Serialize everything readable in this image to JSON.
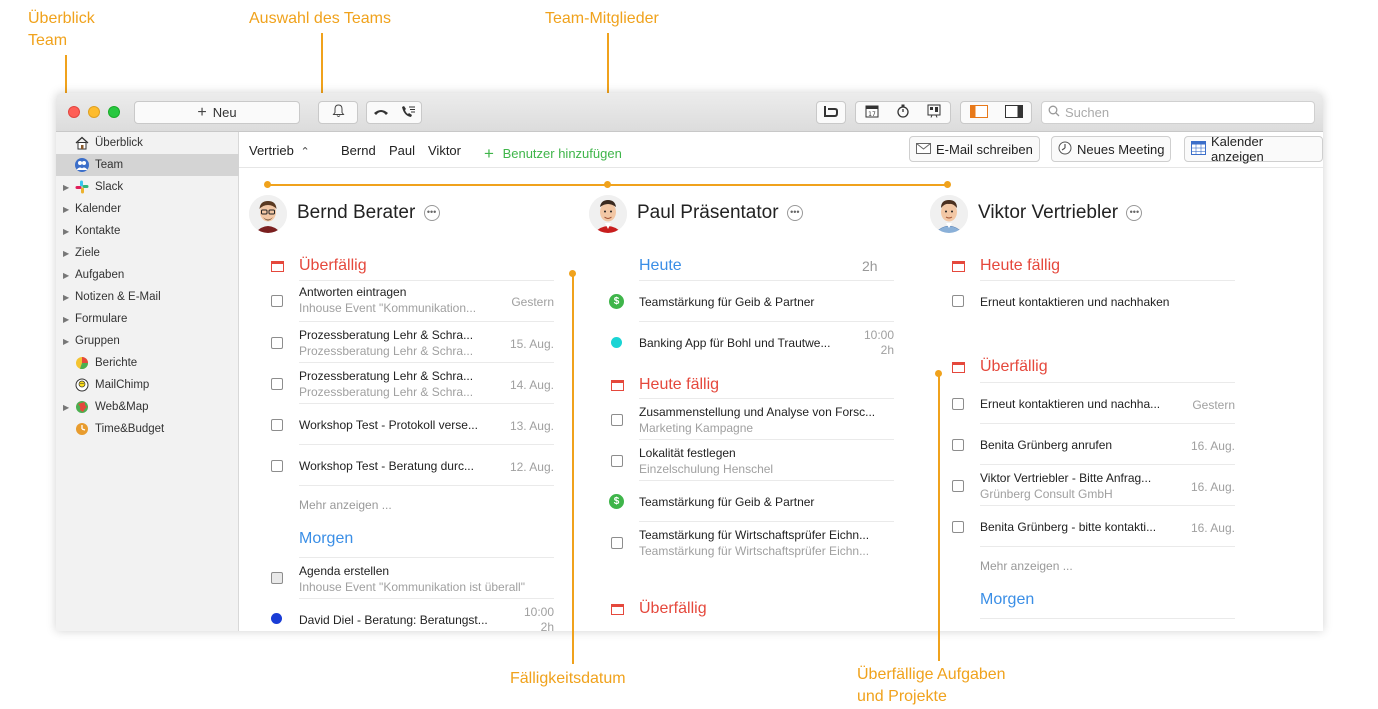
{
  "callouts": {
    "overview_team_line1": "Überblick",
    "overview_team_line2": "Team",
    "team_selection": "Auswahl des Teams",
    "team_members": "Team-Mitglieder",
    "due_date": "Fälligkeitsdatum",
    "overdue_line1": "Überfällige Aufgaben",
    "overdue_line2": "und Projekte"
  },
  "colors": {
    "accent": "#f0a21c",
    "red": "#e5483c",
    "blue": "#3a8ee6",
    "green": "#3fb54a"
  },
  "toolbar": {
    "new_label": "Neu",
    "search_placeholder": "Suchen",
    "icons": [
      "bell-icon",
      "hangup-icon",
      "call-list-icon",
      "brand-icon",
      "calendar-icon",
      "timer-icon",
      "board-icon",
      "sidebar-left-icon",
      "sidebar-right-icon",
      "search-icon"
    ]
  },
  "sidebar": {
    "items": [
      {
        "label": "Überblick",
        "icon": "home-icon"
      },
      {
        "label": "Team",
        "icon": "team-icon"
      },
      {
        "label": "Slack",
        "icon": "slack-icon"
      },
      {
        "label": "Kalender"
      },
      {
        "label": "Kontakte"
      },
      {
        "label": "Ziele"
      },
      {
        "label": "Aufgaben"
      },
      {
        "label": "Notizen & E-Mail"
      },
      {
        "label": "Formulare"
      },
      {
        "label": "Gruppen"
      },
      {
        "label": "Berichte",
        "icon": "reports-icon"
      },
      {
        "label": "MailChimp",
        "icon": "mailchimp-icon"
      },
      {
        "label": "Web&Map",
        "icon": "webmap-icon"
      },
      {
        "label": "Time&Budget",
        "icon": "timebudget-icon"
      }
    ]
  },
  "teambar": {
    "team_name": "Vertrieb",
    "members": [
      "Bernd",
      "Paul",
      "Viktor"
    ],
    "add_user": "Benutzer hinzufügen",
    "write_email": "E-Mail schreiben",
    "new_meeting": "Neues Meeting",
    "show_calendar": "Kalender anzeigen"
  },
  "columns": [
    {
      "name": "Bernd Berater",
      "sections": [
        {
          "title": "Überfällig",
          "tasks": [
            {
              "title": "Antworten eintragen",
              "sub": "Inhouse Event \"Kommunikation...",
              "date": "Gestern"
            },
            {
              "title": "Prozessberatung Lehr & Schra...",
              "sub": "Prozessberatung Lehr & Schra...",
              "date": "15. Aug."
            },
            {
              "title": "Prozessberatung Lehr & Schra...",
              "sub": "Prozessberatung Lehr & Schra...",
              "date": "14. Aug."
            },
            {
              "title": "Workshop Test - Protokoll verse...",
              "date": "13. Aug."
            },
            {
              "title": "Workshop Test - Beratung durc...",
              "date": "12. Aug."
            }
          ],
          "more": "Mehr anzeigen ..."
        },
        {
          "title": "Morgen",
          "tasks": [
            {
              "title": "Agenda erstellen",
              "sub": "Inhouse Event \"Kommunikation ist überall\""
            },
            {
              "title": "David Diel - Beratung: Beratungst...",
              "date": "10:00",
              "date2": "2h"
            }
          ]
        }
      ]
    },
    {
      "name": "Paul Präsentator",
      "sections": [
        {
          "title": "Heute",
          "right": "2h",
          "tasks": [
            {
              "title": "Teamstärkung für Geib & Partner"
            },
            {
              "title": "Banking App für Bohl und Trautwe...",
              "date": "10:00",
              "date2": "2h"
            }
          ]
        },
        {
          "title": "Heute fällig",
          "tasks": [
            {
              "title": "Zusammenstellung und Analyse von Forsc...",
              "sub": "Marketing Kampagne"
            },
            {
              "title": "Lokalität festlegen",
              "sub": "Einzelschulung Henschel"
            },
            {
              "title": "Teamstärkung für Geib & Partner"
            },
            {
              "title": "Teamstärkung für Wirtschaftsprüfer Eichn...",
              "sub": "Teamstärkung für Wirtschaftsprüfer Eichn..."
            }
          ]
        },
        {
          "title": "Überfällig",
          "tasks": []
        }
      ]
    },
    {
      "name": "Viktor Vertriebler",
      "sections": [
        {
          "title": "Heute fällig",
          "tasks": [
            {
              "title": "Erneut kontaktieren und nachhaken"
            }
          ]
        },
        {
          "title": "Überfällig",
          "tasks": [
            {
              "title": "Erneut kontaktieren und nachha...",
              "date": "Gestern"
            },
            {
              "title": "Benita Grünberg anrufen",
              "date": "16. Aug."
            },
            {
              "title": "Viktor Vertriebler - Bitte Anfrag...",
              "sub": "Grünberg Consult GmbH",
              "date": "16. Aug."
            },
            {
              "title": "Benita Grünberg - bitte kontakti...",
              "date": "16. Aug."
            }
          ],
          "more": "Mehr anzeigen ..."
        },
        {
          "title": "Morgen",
          "tasks": []
        }
      ]
    }
  ]
}
